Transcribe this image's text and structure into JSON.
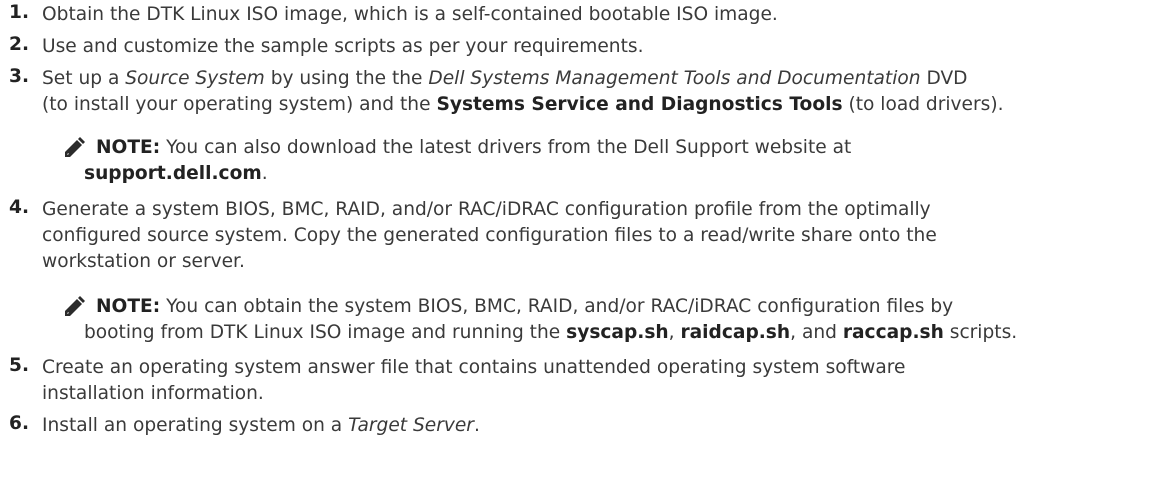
{
  "steps": [
    {
      "number": "1.",
      "line1": "Obtain the DTK Linux ISO image, which is a self-contained bootable ISO image."
    },
    {
      "number": "2.",
      "line1": "Use and customize the sample scripts as per your requirements."
    },
    {
      "number": "3.",
      "l1_a": "Set up a ",
      "l1_b": "Source System",
      "l1_c": " by using the the ",
      "l1_d": "Dell Systems Management Tools and Documentation",
      "l1_e": " DVD",
      "l2_a": "(to install your operating system) and the ",
      "l2_b": "Systems Service and Diagnostics Tools",
      "l2_c": " (to load drivers)."
    },
    {
      "number": "4.",
      "line1": "Generate a system BIOS, BMC, RAID, and/or RAC/iDRAC configuration profile from the optimally",
      "line2": "configured source system. Copy the generated configuration files to a read/write share onto the",
      "line3": "workstation or server."
    },
    {
      "number": "5.",
      "line1": "Create an operating system answer file that contains unattended operating system software",
      "line2": "installation information."
    },
    {
      "number": "6.",
      "l1_a": "Install an operating system on a ",
      "l1_b": "Target Server",
      "l1_c": "."
    }
  ],
  "notes": [
    {
      "label": "NOTE:",
      "l1": " You can also download the latest drivers from the Dell Support website at",
      "link": "support.dell.com",
      "after": "."
    },
    {
      "label": "NOTE:",
      "l1": " You can obtain the system BIOS, BMC, RAID, and/or RAC/iDRAC configuration files by",
      "l2_a": "booting from DTK Linux ISO image and running the ",
      "script1": "syscap.sh",
      "sep1": ", ",
      "script2": "raidcap.sh",
      "sep2": ", and ",
      "script3": "raccap.sh",
      "l2_end": " scripts."
    }
  ],
  "icons": {
    "note": "note-pencil-icon"
  }
}
